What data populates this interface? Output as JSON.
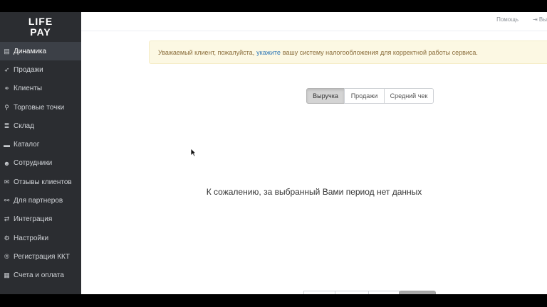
{
  "logo": {
    "line1": "LIFE",
    "line2": "PAY"
  },
  "sidebar": {
    "items": [
      {
        "label": "Динамика",
        "icon": "bar-chart-icon",
        "glyph": "▤",
        "active": true
      },
      {
        "label": "Продажи",
        "icon": "rocket-icon",
        "glyph": "➶",
        "active": false
      },
      {
        "label": "Клиенты",
        "icon": "link-icon",
        "glyph": "⚭",
        "active": false
      },
      {
        "label": "Торговые точки",
        "icon": "map-marker-icon",
        "glyph": "⚲",
        "active": false
      },
      {
        "label": "Склад",
        "icon": "database-icon",
        "glyph": "≣",
        "active": false
      },
      {
        "label": "Каталог",
        "icon": "folder-icon",
        "glyph": "▬",
        "active": false
      },
      {
        "label": "Сотрудники",
        "icon": "users-icon",
        "glyph": "☻",
        "active": false
      },
      {
        "label": "Отзывы клиентов",
        "icon": "comments-icon",
        "glyph": "✉",
        "active": false
      },
      {
        "label": "Для партнеров",
        "icon": "handshake-icon",
        "glyph": "⚯",
        "active": false
      },
      {
        "label": "Интеграция",
        "icon": "exchange-icon",
        "glyph": "⇄",
        "active": false
      },
      {
        "label": "Настройки",
        "icon": "gears-icon",
        "glyph": "⚙",
        "active": false
      },
      {
        "label": "Регистрация ККТ",
        "icon": "registered-icon",
        "glyph": "®",
        "active": false
      },
      {
        "label": "Счета и оплата",
        "icon": "calculator-icon",
        "glyph": "▦",
        "active": false
      }
    ]
  },
  "topbar": {
    "help": "Помощь",
    "exit": "Вы",
    "exit_icon": "sign-out-icon"
  },
  "alert": {
    "before": "Уважаемый клиент, пожалуйста,",
    "link": "укажите",
    "after": "вашу систему налогообложения для корректной работы сервиса."
  },
  "tabs": [
    {
      "label": "Выручка",
      "active": true
    },
    {
      "label": "Продажи",
      "active": false
    },
    {
      "label": "Средний чек",
      "active": false
    }
  ],
  "empty_message": "К сожалению, за выбранный Вами период нет данных",
  "colors": {
    "sidebar_bg": "#2b2d31",
    "active_item_bg": "#3c4047",
    "alert_bg": "#fcf8e3",
    "alert_text": "#8a6d3b",
    "link": "#337ab7"
  }
}
